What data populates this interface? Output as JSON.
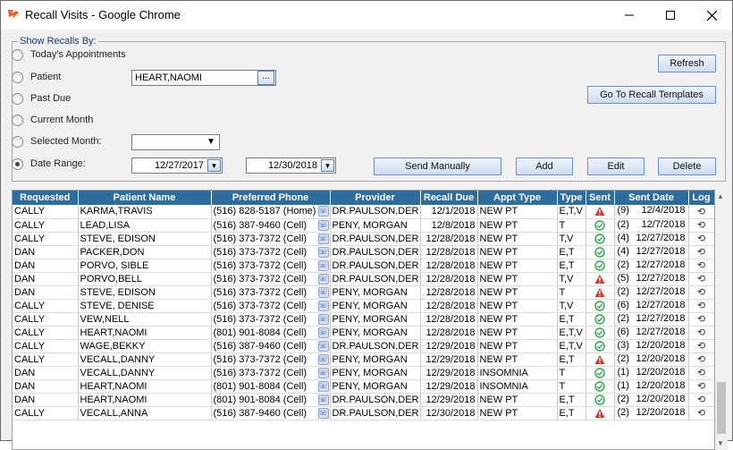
{
  "window": {
    "title": "Recall Visits - Google Chrome",
    "icon": "app-logo-icon"
  },
  "filters": {
    "group_label": "Show Recalls By:",
    "options": [
      {
        "label": "Today's Appointments",
        "checked": false
      },
      {
        "label": "Patient",
        "checked": false
      },
      {
        "label": "Past Due",
        "checked": false
      },
      {
        "label": "Current Month",
        "checked": false
      },
      {
        "label": "Selected Month:",
        "checked": false
      },
      {
        "label": "Date Range:",
        "checked": true
      }
    ],
    "patient_value": "HEART,NAOMI",
    "patient_lookup_label": "...",
    "selected_month_value": "",
    "date_from": "12/27/2017",
    "date_to": "12/30/2018"
  },
  "buttons": {
    "refresh": "Refresh",
    "recall_templates": "Go To Recall Templates",
    "send_manually": "Send Manually",
    "add": "Add",
    "edit": "Edit",
    "delete": "Delete"
  },
  "grid": {
    "columns": [
      "Requested",
      "Patient Name",
      "Preferred Phone",
      "Provider",
      "Recall Due",
      "Appt Type",
      "Type",
      "Sent",
      "Sent Date",
      "Log"
    ],
    "rows": [
      {
        "requested": "CALLY",
        "patient": "KARMA,TRAVIS",
        "phone": "(516) 828-5187 (Home)",
        "provider": "DR.PAULSON,DER",
        "due": "12/1/2018",
        "appt": "NEW PT",
        "type": "E,T,V",
        "sent": "warn",
        "count": "(9)",
        "date": "12/4/2018"
      },
      {
        "requested": "CALLY",
        "patient": "LEAD,LISA",
        "phone": "(516) 387-9460 (Cell)",
        "provider": "PENY, MORGAN",
        "due": "12/8/2018",
        "appt": "NEW PT",
        "type": "T",
        "sent": "ok",
        "count": "(2)",
        "date": "12/7/2018"
      },
      {
        "requested": "CALLY",
        "patient": "STEVE, EDISON",
        "phone": "(516) 373-7372 (Cell)",
        "provider": "DR.PAULSON,DER",
        "due": "12/28/2018",
        "appt": "NEW PT",
        "type": "T,V",
        "sent": "ok",
        "count": "(4)",
        "date": "12/27/2018"
      },
      {
        "requested": "DAN",
        "patient": "PACKER,DON",
        "phone": "(516) 373-7372 (Cell)",
        "provider": "DR.PAULSON,DER",
        "due": "12/28/2018",
        "appt": "NEW PT",
        "type": "E,T",
        "sent": "ok",
        "count": "(4)",
        "date": "12/27/2018"
      },
      {
        "requested": "DAN",
        "patient": "PORVO, SIBLE",
        "phone": "(516) 373-7372 (Cell)",
        "provider": "DR.PAULSON,DER",
        "due": "12/28/2018",
        "appt": "NEW PT",
        "type": "E,T",
        "sent": "ok",
        "count": "(2)",
        "date": "12/27/2018"
      },
      {
        "requested": "DAN",
        "patient": "PORVO,BELL",
        "phone": "(516) 373-7372 (Cell)",
        "provider": "DR.PAULSON,DER",
        "due": "12/28/2018",
        "appt": "NEW PT",
        "type": "T,V",
        "sent": "warn",
        "count": "(5)",
        "date": "12/27/2018"
      },
      {
        "requested": "DAN",
        "patient": "STEVE, EDISON",
        "phone": "(516) 373-7372 (Cell)",
        "provider": "PENY, MORGAN",
        "due": "12/28/2018",
        "appt": "NEW PT",
        "type": "T",
        "sent": "warn",
        "count": "(2)",
        "date": "12/27/2018"
      },
      {
        "requested": "CALLY",
        "patient": "STEVE, DENISE",
        "phone": "(516) 373-7372 (Cell)",
        "provider": "PENY, MORGAN",
        "due": "12/28/2018",
        "appt": "NEW PT",
        "type": "T,V",
        "sent": "ok",
        "count": "(6)",
        "date": "12/27/2018"
      },
      {
        "requested": "CALLY",
        "patient": "VEW,NELL",
        "phone": "(516) 373-7372 (Cell)",
        "provider": "PENY, MORGAN",
        "due": "12/28/2018",
        "appt": "NEW PT",
        "type": "E,T",
        "sent": "ok",
        "count": "(2)",
        "date": "12/27/2018"
      },
      {
        "requested": "CALLY",
        "patient": "HEART,NAOMI",
        "phone": "(801) 901-8084 (Cell)",
        "provider": "PENY, MORGAN",
        "due": "12/28/2018",
        "appt": "NEW PT",
        "type": "E,T,V",
        "sent": "ok",
        "count": "(6)",
        "date": "12/27/2018"
      },
      {
        "requested": "CALLY",
        "patient": "WAGE,BEKKY",
        "phone": "(516) 387-9460 (Cell)",
        "provider": "DR.PAULSON,DER",
        "due": "12/29/2018",
        "appt": "NEW PT",
        "type": "E,T,V",
        "sent": "ok",
        "count": "(3)",
        "date": "12/20/2018"
      },
      {
        "requested": "CALLY",
        "patient": "VECALL,DANNY",
        "phone": "(516) 373-7372 (Cell)",
        "provider": "PENY, MORGAN",
        "due": "12/29/2018",
        "appt": "NEW PT",
        "type": "E,T",
        "sent": "warn",
        "count": "(2)",
        "date": "12/20/2018"
      },
      {
        "requested": "DAN",
        "patient": "VECALL,DANNY",
        "phone": "(516) 373-7372 (Cell)",
        "provider": "PENY, MORGAN",
        "due": "12/29/2018",
        "appt": "INSOMNIA",
        "type": "T",
        "sent": "ok",
        "count": "(1)",
        "date": "12/20/2018"
      },
      {
        "requested": "DAN",
        "patient": "HEART,NAOMI",
        "phone": "(801) 901-8084 (Cell)",
        "provider": "PENY, MORGAN",
        "due": "12/29/2018",
        "appt": "INSOMNIA",
        "type": "T",
        "sent": "ok",
        "count": "(1)",
        "date": "12/20/2018"
      },
      {
        "requested": "DAN",
        "patient": "HEART,NAOMI",
        "phone": "(801) 901-8084 (Cell)",
        "provider": "DR.PAULSON,DER",
        "due": "12/29/2018",
        "appt": "NEW PT",
        "type": "E,T",
        "sent": "ok",
        "count": "(2)",
        "date": "12/20/2018"
      },
      {
        "requested": "CALLY",
        "patient": "VECALL,ANNA",
        "phone": "(516) 387-9460 (Cell)",
        "provider": "DR.PAULSON,DER",
        "due": "12/30/2018",
        "appt": "NEW PT",
        "type": "E,T",
        "sent": "warn",
        "count": "(2)",
        "date": "12/20/2018"
      }
    ]
  },
  "colors": {
    "header_bg": "#2d6d9d",
    "sent_ok": "#2aa84a",
    "sent_warn": "#d9342b"
  }
}
